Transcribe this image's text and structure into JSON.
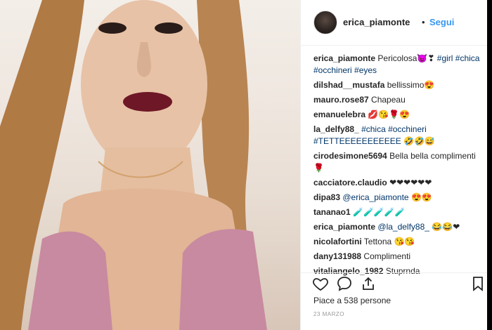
{
  "post": {
    "username": "erica_piamonte",
    "separator": "•",
    "follow_label": "Segui",
    "likes_text": "Piace a 538 persone",
    "date_text": "23 MARZO"
  },
  "comments": [
    {
      "user": "erica_piamonte",
      "text": "Pericolosa😈❣",
      "tags": " #girl #chica #occhineri #eyes"
    },
    {
      "user": "dilshad__mustafa",
      "text": "bellissimo😍",
      "tags": ""
    },
    {
      "user": "mauro.rose87",
      "text": "Chapeau",
      "tags": ""
    },
    {
      "user": "emanuelebra",
      "text": "💋😘🌹😍",
      "tags": ""
    },
    {
      "user": "la_delfy88_",
      "text": "",
      "tags": "#chica #occhineri #TETTEEEEEEEEEEE 🤣🤣😅"
    },
    {
      "user": "cirodesimone5694",
      "text": "Bella bella complimenti 🌹",
      "tags": ""
    },
    {
      "user": "cacciatore.claudio",
      "text": "❤❤❤❤❤❤",
      "tags": ""
    },
    {
      "user": "dipa83",
      "text": "😍😍",
      "tags": "@erica_piamonte"
    },
    {
      "user": "tananao1",
      "text": "🧪🧪🧪🧪🧪",
      "tags": ""
    },
    {
      "user": "erica_piamonte",
      "text": "😂😂❤",
      "tags": "@la_delfy88_"
    },
    {
      "user": "nicolafortini",
      "text": "Tettona 😘😘",
      "tags": ""
    },
    {
      "user": "dany131988",
      "text": "Complimenti",
      "tags": ""
    },
    {
      "user": "vitaliangelo_1982",
      "text": "Stuprnda",
      "tags": ""
    }
  ],
  "icons": {
    "like": "heart-icon",
    "comment": "speech-bubble-icon",
    "share": "share-icon",
    "save": "bookmark-icon"
  }
}
